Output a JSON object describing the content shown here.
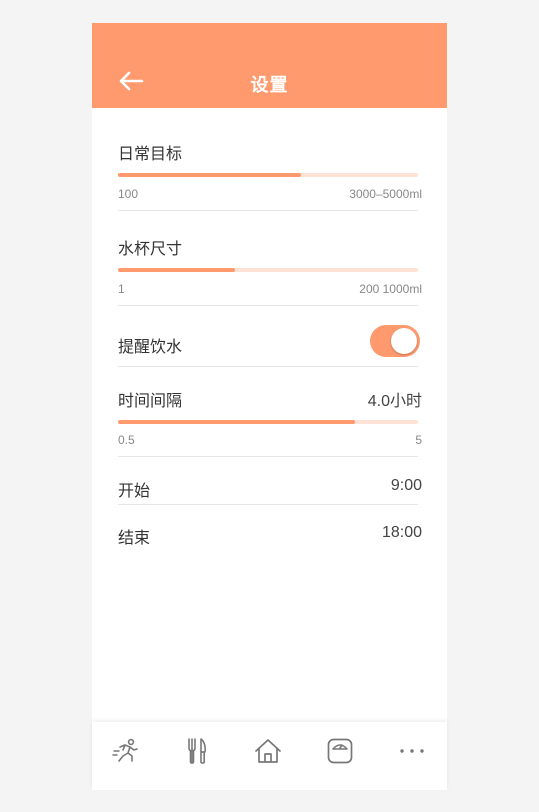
{
  "header": {
    "title": "设置",
    "back_icon": "arrow-left-icon"
  },
  "settings": {
    "daily_goal": {
      "label": "日常目标",
      "min": "100",
      "max": "3000–5000ml",
      "fraction": 0.61
    },
    "cup_size": {
      "label": "水杯尺寸",
      "min": "1",
      "max": "200 1000ml",
      "fraction": 0.39
    },
    "reminder": {
      "label": "提醒饮水",
      "enabled": true
    },
    "interval": {
      "label": "时间间隔",
      "value": "4.0小时",
      "min": "0.5",
      "max": "5",
      "fraction": 0.79
    },
    "start": {
      "label": "开始",
      "value": "9:00"
    },
    "end": {
      "label": "结束",
      "value": "18:00"
    }
  },
  "tabbar": {
    "items": [
      {
        "icon": "running-icon"
      },
      {
        "icon": "fork-knife-icon"
      },
      {
        "icon": "home-icon"
      },
      {
        "icon": "scale-icon"
      },
      {
        "icon": "more-icon"
      }
    ]
  },
  "colors": {
    "accent": "#ff9a6e",
    "track": "#ffe2d6",
    "text": "#333333"
  }
}
